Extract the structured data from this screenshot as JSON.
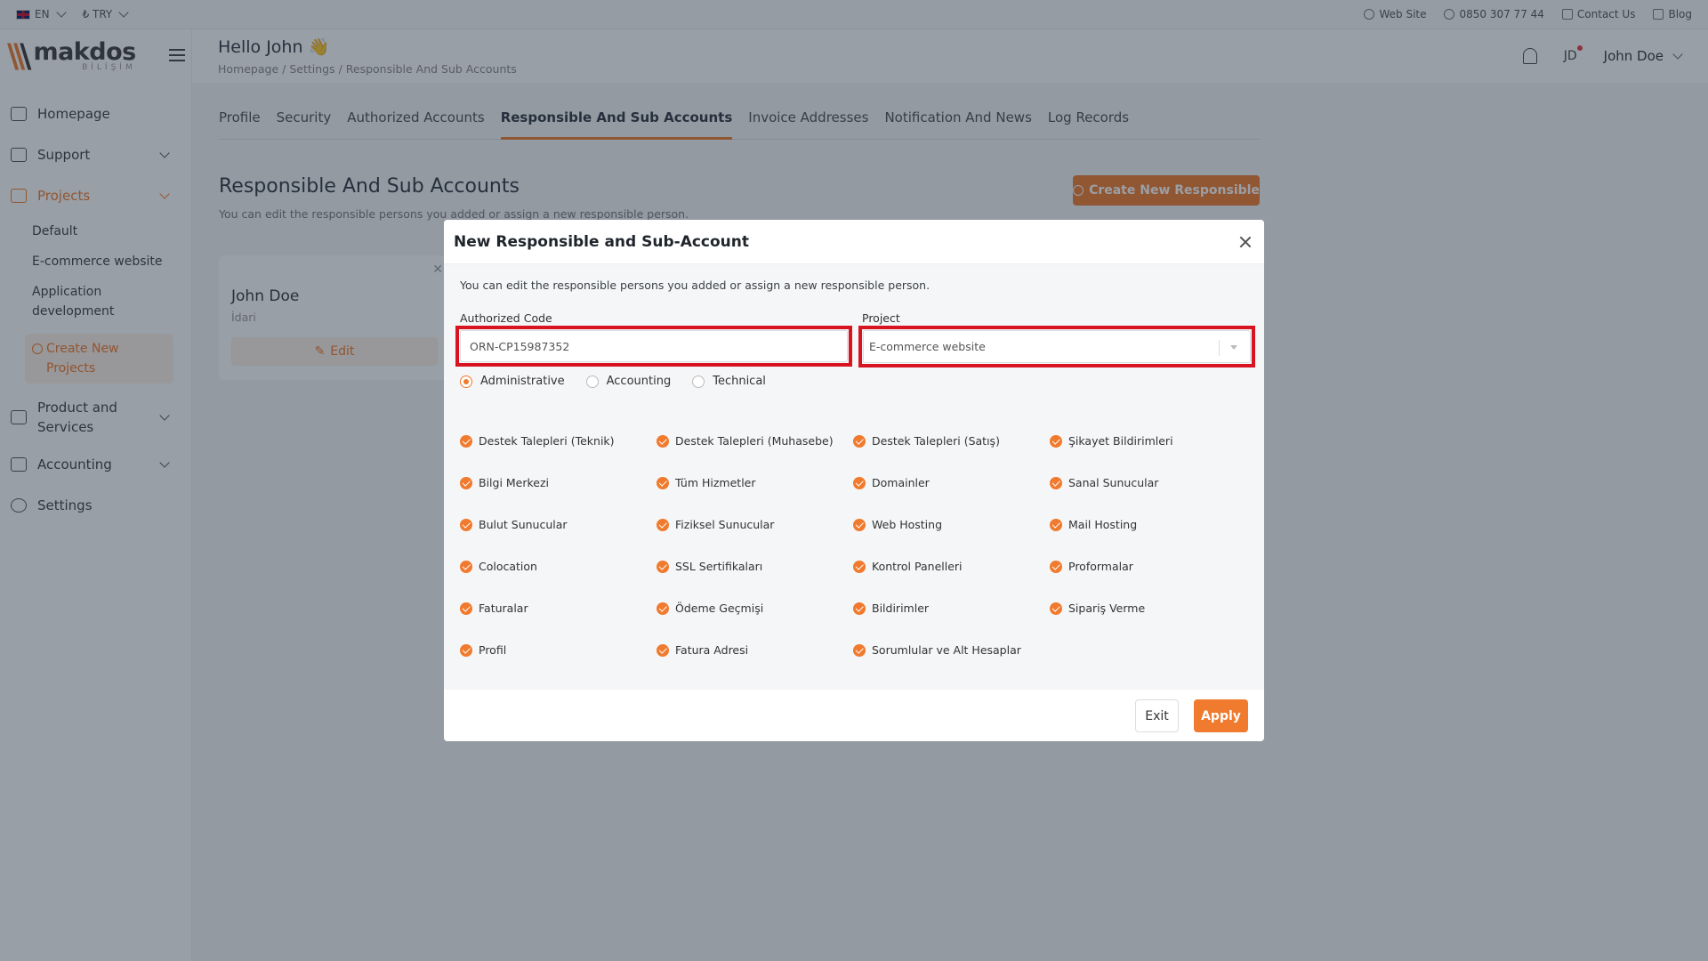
{
  "topbar": {
    "language": "EN",
    "currency": "₺ TRY",
    "links": [
      {
        "label": "Web Site",
        "icon": "globe-icon"
      },
      {
        "label": "0850 307 77 44",
        "icon": "headset-icon"
      },
      {
        "label": "Contact Us",
        "icon": "mail-icon"
      },
      {
        "label": "Blog",
        "icon": "external-link-icon"
      }
    ]
  },
  "brand": {
    "mark": "\\\\\\",
    "name": "makdos",
    "sub": "BİLİŞİM"
  },
  "header": {
    "greeting": "Hello John 👋",
    "breadcrumb": [
      "Homepage",
      "Settings",
      "Responsible And Sub Accounts"
    ],
    "avatar_initials": "JD",
    "user_name": "John Doe"
  },
  "sidebar": {
    "items": [
      {
        "label": "Homepage",
        "icon": "home-icon"
      },
      {
        "label": "Support",
        "icon": "chat-icon"
      },
      {
        "label": "Projects",
        "icon": "folder-icon"
      },
      {
        "label": "Product and Services",
        "icon": "list-icon"
      },
      {
        "label": "Accounting",
        "icon": "coins-icon"
      },
      {
        "label": "Settings",
        "icon": "gear-icon"
      }
    ],
    "projects": [
      "Default",
      "E-commerce website",
      "Application development"
    ],
    "create_project": "Create New Projects"
  },
  "tabs": [
    "Profile",
    "Security",
    "Authorized Accounts",
    "Responsible And Sub Accounts",
    "Invoice Addresses",
    "Notification And News",
    "Log Records"
  ],
  "page": {
    "title": "Responsible And Sub Accounts",
    "description": "You can edit the responsible persons you added or assign a new responsible person.",
    "create_button": "Create New Responsible"
  },
  "card": {
    "name": "John Doe",
    "role": "İdari",
    "edit": "Edit"
  },
  "modal": {
    "title": "New Responsible and Sub-Account",
    "description": "You can edit the responsible persons you added or assign a new responsible person.",
    "authorized_code_label": "Authorized Code",
    "authorized_code_value": "ORN-CP15987352",
    "project_label": "Project",
    "project_value": "E-commerce website",
    "roles": [
      "Administrative",
      "Accounting",
      "Technical"
    ],
    "selected_role": "Administrative",
    "permissions": [
      "Destek Talepleri (Teknik)",
      "Destek Talepleri (Muhasebe)",
      "Destek Talepleri (Satış)",
      "Şikayet Bildirimleri",
      "Bilgi Merkezi",
      "Tüm Hizmetler",
      "Domainler",
      "Sanal Sunucular",
      "Bulut Sunucular",
      "Fiziksel Sunucular",
      "Web Hosting",
      "Mail Hosting",
      "Colocation",
      "SSL Sertifikaları",
      "Kontrol Panelleri",
      "Proformalar",
      "Faturalar",
      "Ödeme Geçmişi",
      "Bildirimler",
      "Sipariş Verme",
      "Profil",
      "Fatura Adresi",
      "Sorumlular ve Alt Hesaplar"
    ],
    "exit_label": "Exit",
    "apply_label": "Apply"
  },
  "colors": {
    "accent": "#f07a2d",
    "highlight": "#d7141f",
    "overlay": "rgba(28,42,58,0.45)"
  }
}
